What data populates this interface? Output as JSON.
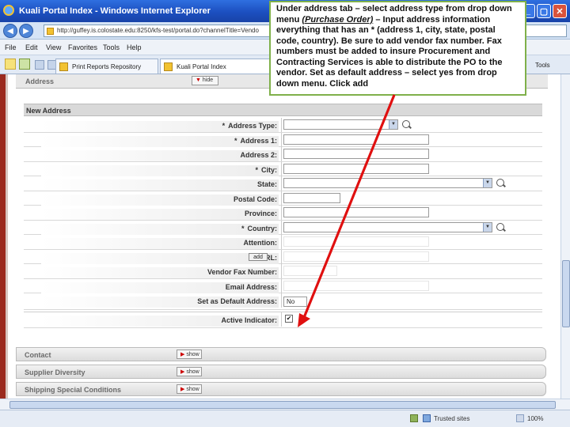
{
  "window": {
    "title": "Kuali Portal Index - Windows Internet Explorer",
    "controls": [
      "_",
      "▢",
      "✕"
    ]
  },
  "address_bar": {
    "url": "http://guffey.is.colostate.edu:8250/kfs-test/portal.do?channelTitle=Vendo"
  },
  "menu": {
    "items": [
      "File",
      "Edit",
      "View",
      "Favorites",
      "Tools",
      "Help"
    ],
    "tools_label": "Tools"
  },
  "tabs": [
    {
      "label": "Print Reports Repository"
    },
    {
      "label": "Kuali Portal Index"
    }
  ],
  "page": {
    "address_section": {
      "label": "Address",
      "hide_label": "hide"
    },
    "new_address_header": "New Address",
    "fields": [
      {
        "label": "Address Type:",
        "required": true,
        "value": ""
      },
      {
        "label": "Address 1:",
        "required": true,
        "value": ""
      },
      {
        "label": "Address 2:",
        "required": false,
        "value": ""
      },
      {
        "label": "City:",
        "required": true,
        "value": ""
      },
      {
        "label": "State:",
        "required": false,
        "value": ""
      },
      {
        "label": "Postal Code:",
        "required": false,
        "value": ""
      },
      {
        "label": "Province:",
        "required": false,
        "value": ""
      },
      {
        "label": "Country:",
        "required": true,
        "value": ""
      },
      {
        "label": "Attention:",
        "required": false,
        "value": ""
      },
      {
        "label": "URL:",
        "required": false,
        "value": ""
      },
      {
        "label": "Vendor Fax Number:",
        "required": false,
        "value": ""
      },
      {
        "label": "Email Address:",
        "required": false,
        "value": ""
      },
      {
        "label": "Set as Default Address:",
        "required": false,
        "value": "No"
      },
      {
        "label": "Active Indicator:",
        "required": false,
        "value": "✔"
      }
    ],
    "add_button": "add",
    "sections": [
      {
        "label": "Contact",
        "button": "show"
      },
      {
        "label": "Supplier Diversity",
        "button": "show"
      },
      {
        "label": "Shipping Special Conditions",
        "button": "show"
      }
    ]
  },
  "status_bar": {
    "zone": "Trusted sites",
    "zoom": "100%"
  },
  "callout": {
    "before_link": "Under address tab – select address type from drop down menu ",
    "link": "(Purchase Order)",
    "after_link": " – Input address information everything that has an * (address 1, city, state, postal code, country). Be sure to add vendor fax number. Fax numbers must be added to insure Procurement and Contracting Services is able to distribute the PO to the vendor. Set as default address – select yes from drop down menu. Click add"
  },
  "colors": {
    "callout_border": "#7fb04a",
    "arrow": "#e01010",
    "portal_red": "#9b2a1e"
  }
}
